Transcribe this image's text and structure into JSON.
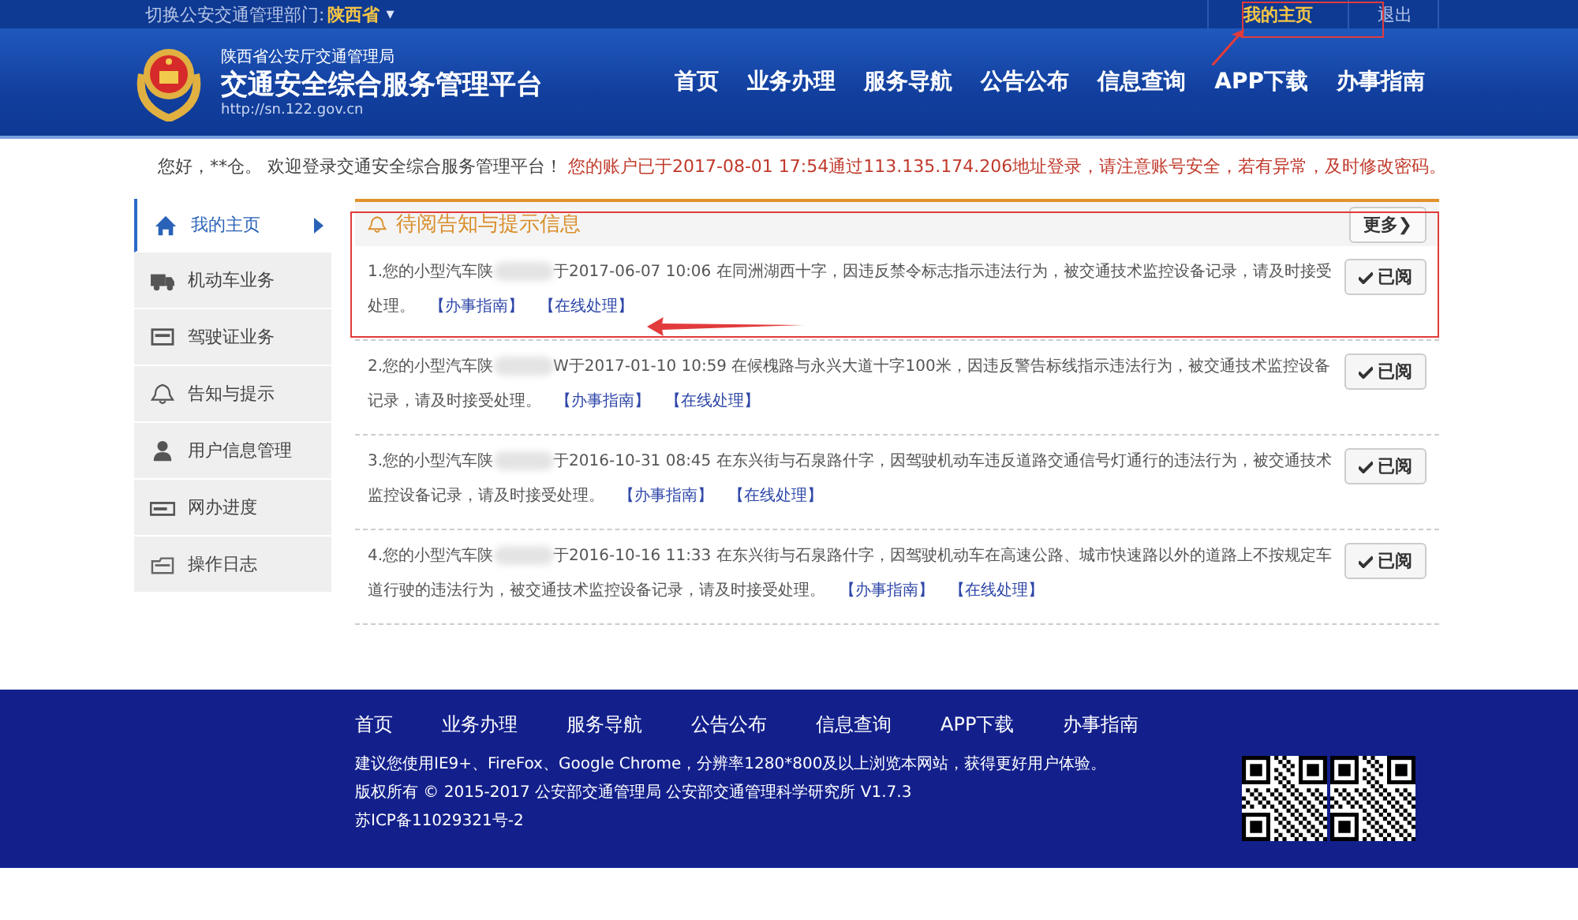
{
  "top_bar": {
    "label": "切换公安交通管理部门:",
    "province": "陕西省",
    "caret": "▾",
    "user_link": "我的主页",
    "logout": "退出"
  },
  "header": {
    "org": "陕西省公安厅交通管理局",
    "title": "交通安全综合服务管理平台",
    "url": "http://sn.122.gov.cn",
    "nav": [
      {
        "label": "首页"
      },
      {
        "label": "业务办理"
      },
      {
        "label": "服务导航"
      },
      {
        "label": "公告公布"
      },
      {
        "label": "信息查询"
      },
      {
        "label": "APP下载"
      },
      {
        "label": "办事指南"
      }
    ]
  },
  "greeting": {
    "welcome": "您好，**仓。 欢迎登录交通安全综合服务管理平台！",
    "warning": "您的账户已于2017-08-01 17:54通过113.135.174.206地址登录，请注意账号安全，若有异常，及时修改密码。"
  },
  "sidebar": {
    "items": [
      {
        "kind": "home",
        "label": "我的主页",
        "selected": true
      },
      {
        "kind": "truck",
        "label": "机动车业务",
        "selected": false
      },
      {
        "kind": "card",
        "label": "驾驶证业务",
        "selected": false
      },
      {
        "kind": "bell",
        "label": "告知与提示",
        "selected": false
      },
      {
        "kind": "user",
        "label": "用户信息管理",
        "selected": false
      },
      {
        "kind": "progress",
        "label": "网办进度",
        "selected": false
      },
      {
        "kind": "log",
        "label": "操作日志",
        "selected": false
      }
    ]
  },
  "notices": {
    "title": "待阅告知与提示信息",
    "more": "更多❯",
    "items": [
      {
        "prefix": "1.您的小型汽车陕",
        "text": "于2017-06-07 10:06 在同洲湖西十字，因违反禁令标志指示违法行为，被交通技术监控设备记录，请及时接受处理。",
        "links": [
          "【办事指南】",
          "【在线处理】"
        ],
        "button": "已阅"
      },
      {
        "prefix": "2.您的小型汽车陕",
        "text": "W于2017-01-10 10:59 在候槐路与永兴大道十字100米，因违反警告标线指示违法行为，被交通技术监控设备记录，请及时接受处理。",
        "links": [
          "【办事指南】",
          "【在线处理】"
        ],
        "button": "已阅"
      },
      {
        "prefix": "3.您的小型汽车陕",
        "text": "于2016-10-31 08:45 在东兴街与石泉路什字，因驾驶机动车违反道路交通信号灯通行的违法行为，被交通技术监控设备记录，请及时接受处理。",
        "links": [
          "【办事指南】",
          "【在线处理】"
        ],
        "button": "已阅"
      },
      {
        "prefix": "4.您的小型汽车陕",
        "text": "于2016-10-16 11:33 在东兴街与石泉路什字，因驾驶机动车在高速公路、城市快速路以外的道路上不按规定车道行驶的违法行为，被交通技术监控设备记录，请及时接受处理。",
        "links": [
          "【办事指南】",
          "【在线处理】"
        ],
        "button": "已阅"
      }
    ]
  },
  "footer": {
    "nav": [
      "首页",
      "业务办理",
      "服务导航",
      "公告公布",
      "信息查询",
      "APP下载",
      "办事指南"
    ],
    "lines": [
      "建议您使用IE9+、FireFox、Google Chrome，分辨率1280*800及以上浏览本网站，获得更好用户体验。",
      "版权所有 © 2015-2017 公安部交通管理局 公安部交通管理科学研究所 V1.7.3",
      "苏ICP备11029321号-2"
    ]
  }
}
